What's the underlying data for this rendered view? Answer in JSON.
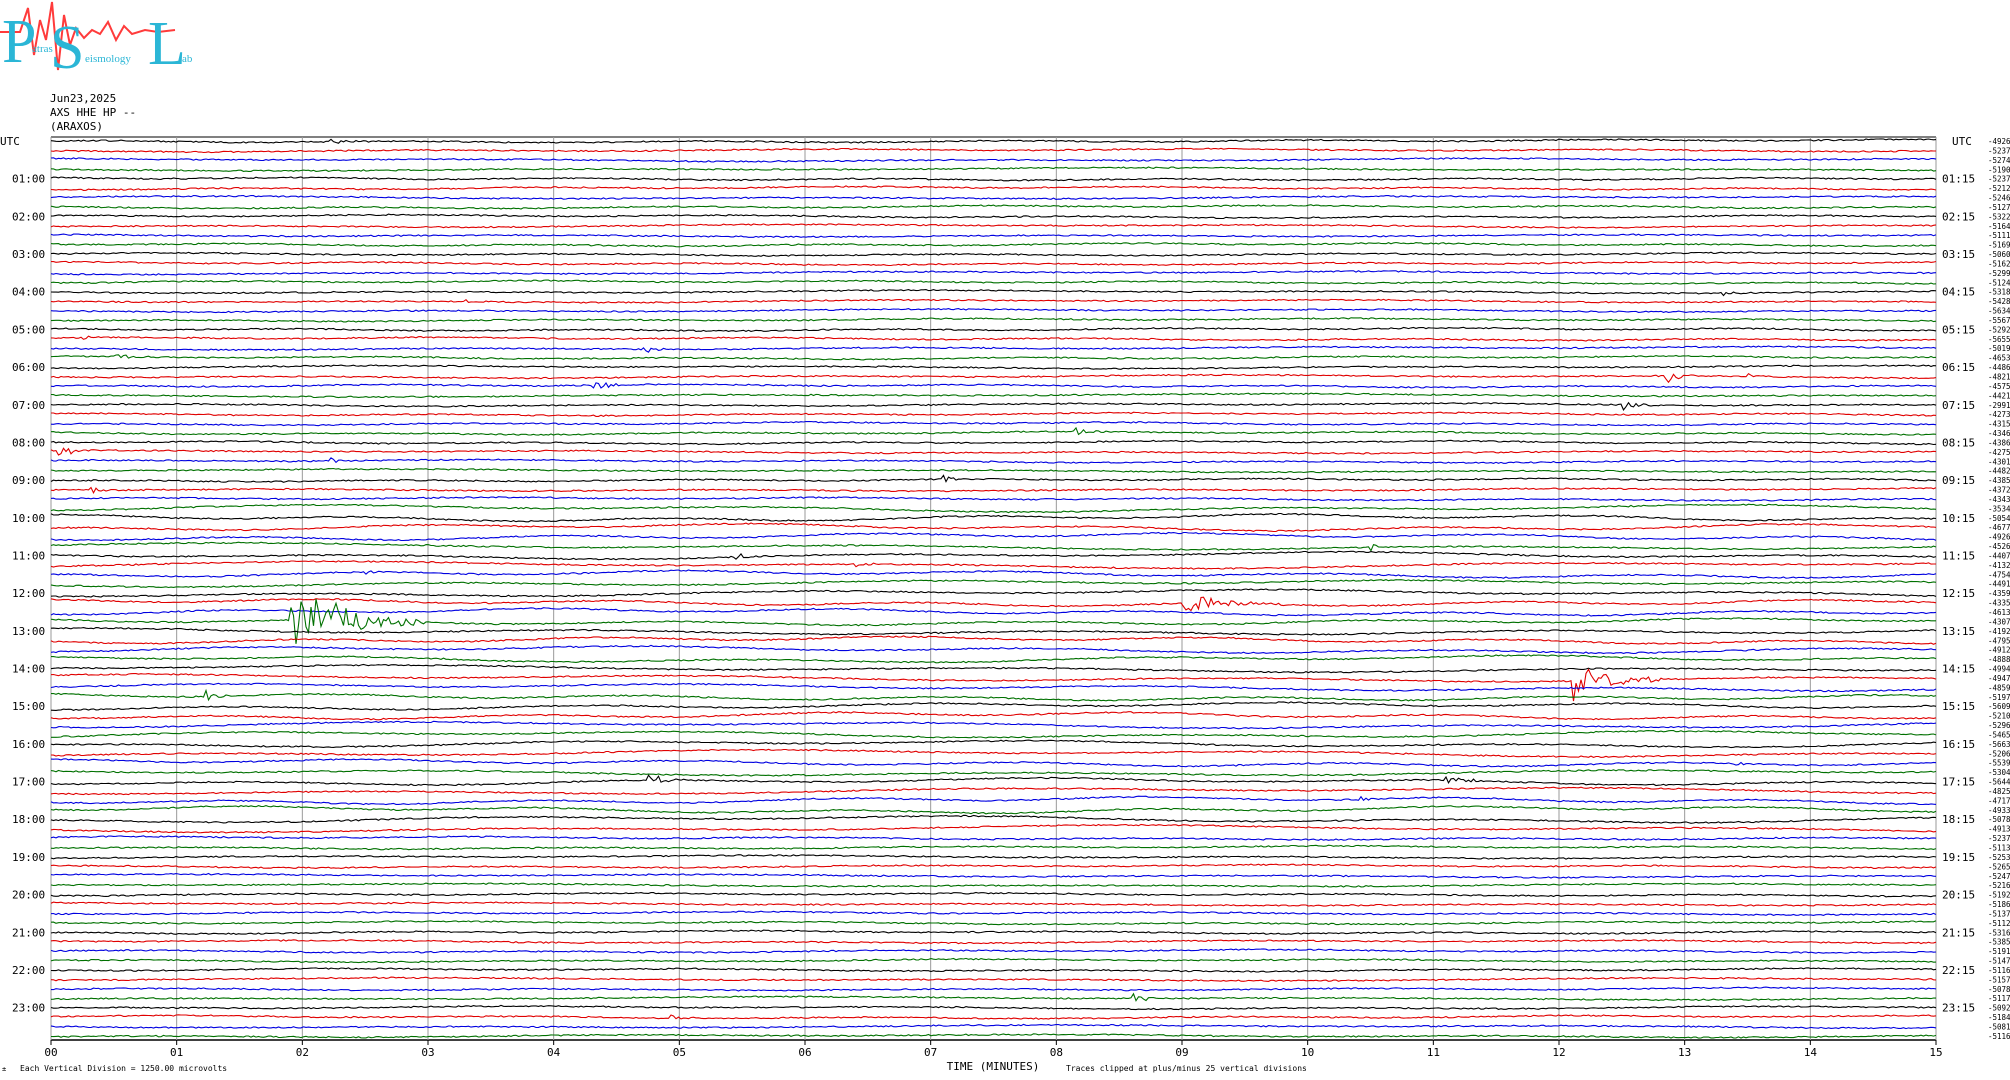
{
  "logo": {
    "big_letters": [
      "P",
      "S",
      "L"
    ],
    "small_words": [
      "atras",
      "eismology",
      "ab"
    ],
    "icon": "seismogram-logo-icon",
    "colors": {
      "letters": "#2bb6d6",
      "wave": "#ff3b3b"
    }
  },
  "header": {
    "date": "Jun23,2025",
    "channel": "AXS HHE HP --",
    "station": "(ARAXOS)"
  },
  "chart_data": {
    "type": "helicorder",
    "left_axis_label": "UTC",
    "right_axis_label": "UTC",
    "left_hour_labels": [
      "01:00",
      "02:00",
      "03:00",
      "04:00",
      "05:00",
      "06:00",
      "07:00",
      "08:00",
      "09:00",
      "10:00",
      "11:00",
      "12:00",
      "13:00",
      "14:00",
      "15:00",
      "16:00",
      "17:00",
      "18:00",
      "19:00",
      "20:00",
      "21:00",
      "22:00",
      "23:00"
    ],
    "right_hour_labels": [
      "01:15",
      "02:15",
      "03:15",
      "04:15",
      "05:15",
      "06:15",
      "07:15",
      "08:15",
      "09:15",
      "10:15",
      "11:15",
      "12:15",
      "13:15",
      "14:15",
      "15:15",
      "16:15",
      "17:15",
      "18:15",
      "19:15",
      "20:15",
      "21:15",
      "22:15",
      "23:15"
    ],
    "x_ticks": [
      "00",
      "01",
      "02",
      "03",
      "04",
      "05",
      "06",
      "07",
      "08",
      "09",
      "10",
      "11",
      "12",
      "13",
      "14",
      "15"
    ],
    "xlim": [
      0,
      15
    ],
    "xlabel": "TIME (MINUTES)",
    "trace_count": 96,
    "trace_minutes": 15,
    "trace_colors": [
      "#000000",
      "#e00000",
      "#0000e0",
      "#007000"
    ],
    "trace_offsets": [
      "-4926",
      "-5237",
      "-5274",
      "-5190",
      "-5237",
      "-5212",
      "-5246",
      "-5127",
      "-5322",
      "-5164",
      "-5111",
      "-5169",
      "-5060",
      "-5162",
      "-5299",
      "-5124",
      "-5318",
      "-5428",
      "-5634",
      "-5567",
      "-5292",
      "-5655",
      "-5019",
      "-4653",
      "-4486",
      "-4821",
      "-4575",
      "-4421",
      "-2991",
      "-4273",
      "-4315",
      "-4346",
      "-4386",
      "-4275",
      "-4301",
      "-4482",
      "-4385",
      "-4372",
      "-4343",
      "-3534",
      "-5054",
      "-4677",
      "-4926",
      "-4526",
      "-4407",
      "-4132",
      "-4754",
      "-4491",
      "-4359",
      "-4335",
      "-4613",
      "-4307",
      "-4192",
      "-4795",
      "-4912",
      "-4888",
      "-4994",
      "-4947",
      "-4859",
      "-5197",
      "-5609",
      "-5210",
      "-5296",
      "-5465",
      "-5663",
      "-5206",
      "-5539",
      "-5304",
      "-5644",
      "-4825",
      "-4717",
      "-4933",
      "-5078",
      "-4913",
      "-5237",
      "-5113",
      "-5253",
      "-5265",
      "-5247",
      "-5216",
      "-5192",
      "-5186",
      "-5137",
      "-5112",
      "-5316",
      "-5385",
      "-5191",
      "-5147",
      "-5116",
      "-5157",
      "-5078",
      "-5117",
      "-5092",
      "-5184",
      "-5081",
      "-5116"
    ],
    "events": [
      {
        "trace": 0,
        "minute": 2.2,
        "amp": 0.3,
        "dur": 0.4
      },
      {
        "trace": 21,
        "minute": 0.25,
        "amp": 0.4,
        "dur": 0.25
      },
      {
        "trace": 21,
        "minute": 10.25,
        "amp": 0.3,
        "dur": 0.2
      },
      {
        "trace": 22,
        "minute": 4.7,
        "amp": 0.45,
        "dur": 0.25
      },
      {
        "trace": 23,
        "minute": 0.5,
        "amp": 0.6,
        "dur": 0.3
      },
      {
        "trace": 17,
        "minute": 3.3,
        "amp": 0.3,
        "dur": 0.2
      },
      {
        "trace": 16,
        "minute": 13.3,
        "amp": 0.5,
        "dur": 0.15
      },
      {
        "trace": 25,
        "minute": 12.85,
        "amp": 0.8,
        "dur": 0.25
      },
      {
        "trace": 25,
        "minute": 13.5,
        "amp": 0.6,
        "dur": 0.2
      },
      {
        "trace": 26,
        "minute": 4.3,
        "amp": 0.9,
        "dur": 0.3
      },
      {
        "trace": 28,
        "minute": 12.5,
        "amp": 0.7,
        "dur": 0.3
      },
      {
        "trace": 31,
        "minute": 8.15,
        "amp": 0.4,
        "dur": 0.25
      },
      {
        "trace": 33,
        "minute": 0.05,
        "amp": 0.8,
        "dur": 0.35
      },
      {
        "trace": 34,
        "minute": 2.2,
        "amp": 0.5,
        "dur": 0.25
      },
      {
        "trace": 36,
        "minute": 7.1,
        "amp": 0.5,
        "dur": 0.2
      },
      {
        "trace": 37,
        "minute": 0.3,
        "amp": 0.5,
        "dur": 0.3
      },
      {
        "trace": 43,
        "minute": 10.5,
        "amp": 0.5,
        "dur": 0.2
      },
      {
        "trace": 44,
        "minute": 5.4,
        "amp": 0.7,
        "dur": 0.3
      },
      {
        "trace": 45,
        "minute": 6.4,
        "amp": 0.4,
        "dur": 0.3
      },
      {
        "trace": 46,
        "minute": 2.45,
        "amp": 0.4,
        "dur": 0.2
      },
      {
        "trace": 49,
        "minute": 9.0,
        "amp": 1.0,
        "dur": 0.9
      },
      {
        "trace": 51,
        "minute": 1.9,
        "amp": 4.5,
        "dur": 1.1
      },
      {
        "trace": 57,
        "minute": 12.1,
        "amp": 2.2,
        "dur": 0.7
      },
      {
        "trace": 57,
        "minute": 12.7,
        "amp": 0.8,
        "dur": 0.2
      },
      {
        "trace": 59,
        "minute": 1.2,
        "amp": 1.1,
        "dur": 0.25
      },
      {
        "trace": 66,
        "minute": 13.4,
        "amp": 0.4,
        "dur": 0.2
      },
      {
        "trace": 68,
        "minute": 4.75,
        "amp": 0.8,
        "dur": 0.3
      },
      {
        "trace": 68,
        "minute": 11.1,
        "amp": 0.9,
        "dur": 0.35
      },
      {
        "trace": 70,
        "minute": 10.4,
        "amp": 0.4,
        "dur": 0.2
      },
      {
        "trace": 91,
        "minute": 8.6,
        "amp": 0.6,
        "dur": 0.3
      },
      {
        "trace": 93,
        "minute": 4.9,
        "amp": 0.5,
        "dur": 0.25
      }
    ]
  },
  "footer": {
    "vertical_division": "Each Vertical Division = 1250.00 microvolts",
    "clip_note": "Traces clipped at plus/minus 25 vertical divisions",
    "corner_mark": "±"
  }
}
